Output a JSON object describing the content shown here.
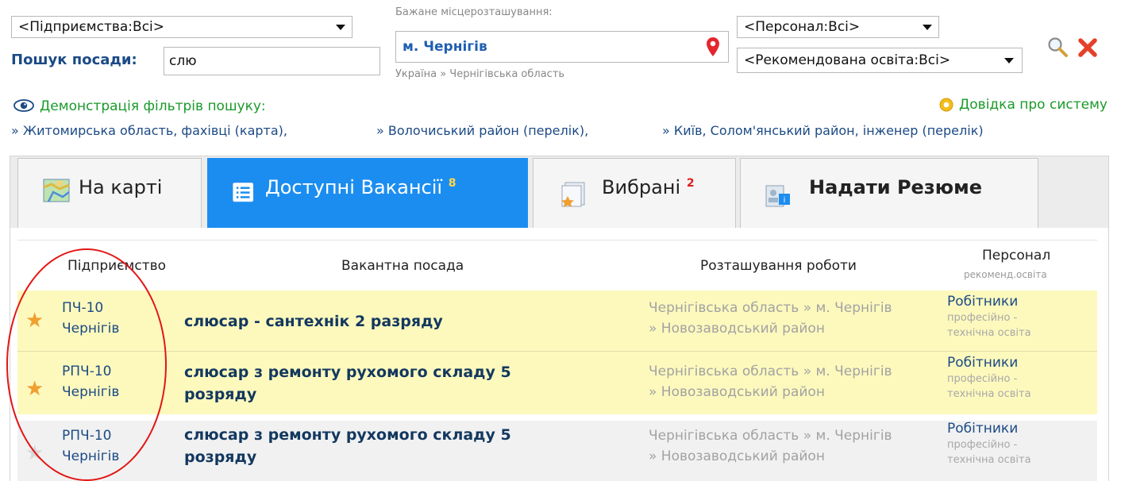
{
  "filters": {
    "enterprise_select": "<Підприємства:Всі>",
    "search_label": "Пошук посади:",
    "search_value": "слю",
    "location_label": "Бажане місцерозташування:",
    "location_value": "м. Чернігів",
    "location_sub": "Україна » Чернігівська область",
    "staff_select": "<Персонал:Всі>",
    "education_select": "<Рекомендована освіта:Всі>"
  },
  "demo": {
    "title": "Демонстрація фільтрів пошуку:",
    "help": "Довідка про систему",
    "links": [
      "» Житомирська область, фахівці (карта),",
      "» Волочиський район (перелік),",
      "» Київ, Солом'янський район, інженер (перелік)"
    ]
  },
  "tabs": [
    {
      "label": "На карті",
      "badge": ""
    },
    {
      "label": "Доступні Вакансії",
      "badge": "8"
    },
    {
      "label": "Вибрані",
      "badge": "2"
    },
    {
      "label": "Надати Резюме",
      "badge": ""
    }
  ],
  "table": {
    "headers": {
      "enterprise": "Підприємство",
      "position": "Вакантна посада",
      "location": "Розташування роботи",
      "staff": "Персонал",
      "staff_sub": "рекоменд.освіта"
    },
    "rows": [
      {
        "company_line1": "ПЧ-10",
        "company_line2": "Чернігів",
        "job_line1": "слюсар - сантехнік 2 разряду",
        "job_line2": "",
        "loc_line1": "Чернігівська область » м. Чернігів",
        "loc_line2": "» Новозаводський район",
        "staff": "Робітники",
        "edu_line1": "професійно -",
        "edu_line2": "технічна освіта",
        "favorite": true
      },
      {
        "company_line1": "РПЧ-10",
        "company_line2": "Чернігів",
        "job_line1": "слюсар з ремонту рухомого складу 5",
        "job_line2": "розряду",
        "loc_line1": "Чернігівська область » м. Чернігів",
        "loc_line2": "» Новозаводський район",
        "staff": "Робітники",
        "edu_line1": "професійно -",
        "edu_line2": "технічна освіта",
        "favorite": true
      },
      {
        "company_line1": "РПЧ-10",
        "company_line2": "Чернігів",
        "job_line1": "слюсар з ремонту рухомого складу 5",
        "job_line2": "розряду",
        "loc_line1": "Чернігівська область » м. Чернігів",
        "loc_line2": "» Новозаводський район",
        "staff": "Робітники",
        "edu_line1": "професійно -",
        "edu_line2": "технічна освіта",
        "favorite": false
      }
    ]
  },
  "colors": {
    "accent": "#1b8df0",
    "favorite_star": "#f0a030",
    "inactive_star": "#d8d8d8",
    "annotation": "#e31515"
  }
}
